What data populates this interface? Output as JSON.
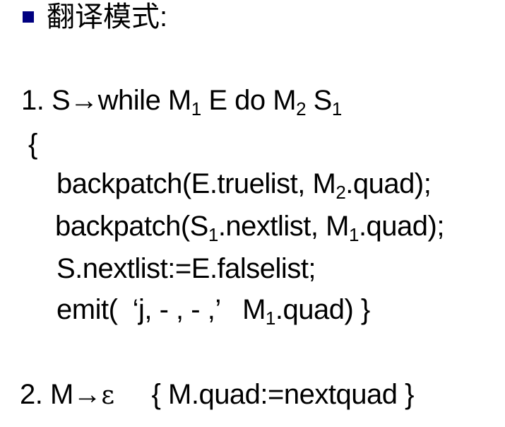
{
  "heading": {
    "text": "翻译模式:",
    "bullet_color": "#000080"
  },
  "rule1": {
    "number": "1.",
    "head": "S→while M",
    "head_sub1": "1",
    "mid": " E do M",
    "mid_sub": "2",
    "tail": " S",
    "tail_sub": "1"
  },
  "open_brace": "{",
  "stmt1": {
    "pre": "backpatch(E.truelist, M",
    "sub": "2",
    "post": ".quad);"
  },
  "stmt2": {
    "pre": "backpatch(S",
    "sub1": "1",
    "mid": ".nextlist, M",
    "sub2": "1",
    "post": ".quad);"
  },
  "stmt3": {
    "text": "S.nextlist:=E.falselist;"
  },
  "stmt4": {
    "pre": "emit(  ‘j, - , - ,’   M",
    "sub": "1",
    "post": ".quad) }"
  },
  "rule2": {
    "number": "2.",
    "head": "M→",
    "epsilon": "ε",
    "action": "     { M.quad:=nextquad }"
  }
}
